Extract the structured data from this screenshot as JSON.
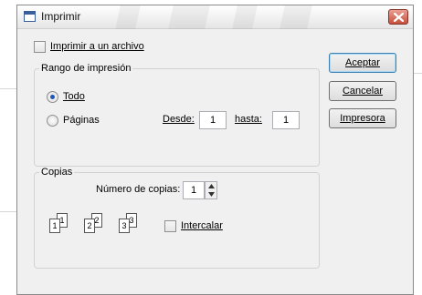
{
  "window": {
    "title": "Imprimir"
  },
  "print_to_file": {
    "label": "Imprimir a un archivo",
    "checked": false
  },
  "range": {
    "title": "Rango de impresión",
    "all_label": "Todo",
    "pages_label": "Páginas",
    "from_label": "Desde:",
    "from_value": "1",
    "to_label": "hasta:",
    "to_value": "1",
    "selected": "all"
  },
  "copies": {
    "title": "Copias",
    "count_label": "Número de copias:",
    "count_value": "1",
    "collate_label": "Intercalar",
    "collate_checked": false,
    "pages": [
      "1",
      "1",
      "2",
      "2",
      "3",
      "3"
    ]
  },
  "buttons": {
    "accept": "Aceptar",
    "cancel": "Cancelar",
    "printer": "Impresora"
  },
  "icons": {
    "app": "window-icon",
    "close": "close-icon",
    "spin_up": "arrow-up-icon",
    "spin_down": "arrow-down-icon"
  },
  "colors": {
    "dialog_bg": "#f0f0f0",
    "close_button": "#c6503c",
    "radio_dot": "#1f57b8",
    "default_button_border": "#3c7fb1"
  }
}
